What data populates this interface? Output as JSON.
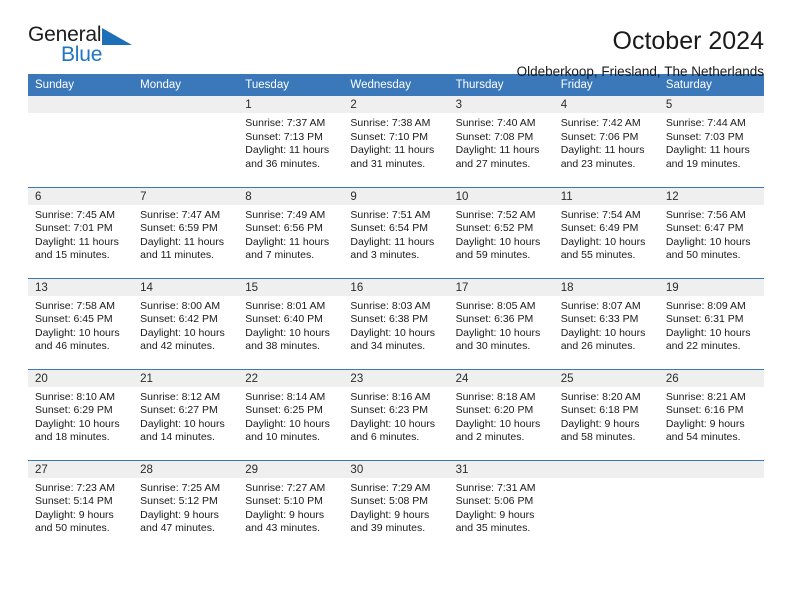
{
  "brand": {
    "name_top": "General",
    "name_bottom": "Blue",
    "accent_color": "#1d6fb8",
    "triangle_icon": "triangle-icon"
  },
  "header": {
    "title": "October 2024",
    "subtitle": "Oldeberkoop, Friesland, The Netherlands"
  },
  "theme": {
    "header_blue": "#3a78ba",
    "daynum_gray": "#efefef",
    "text": "#1a1a1a"
  },
  "weekdays": [
    "Sunday",
    "Monday",
    "Tuesday",
    "Wednesday",
    "Thursday",
    "Friday",
    "Saturday"
  ],
  "weeks": [
    [
      {
        "day": "",
        "sunrise": "",
        "sunset": "",
        "daylight": ""
      },
      {
        "day": "",
        "sunrise": "",
        "sunset": "",
        "daylight": ""
      },
      {
        "day": "1",
        "sunrise": "Sunrise: 7:37 AM",
        "sunset": "Sunset: 7:13 PM",
        "daylight": "Daylight: 11 hours and 36 minutes."
      },
      {
        "day": "2",
        "sunrise": "Sunrise: 7:38 AM",
        "sunset": "Sunset: 7:10 PM",
        "daylight": "Daylight: 11 hours and 31 minutes."
      },
      {
        "day": "3",
        "sunrise": "Sunrise: 7:40 AM",
        "sunset": "Sunset: 7:08 PM",
        "daylight": "Daylight: 11 hours and 27 minutes."
      },
      {
        "day": "4",
        "sunrise": "Sunrise: 7:42 AM",
        "sunset": "Sunset: 7:06 PM",
        "daylight": "Daylight: 11 hours and 23 minutes."
      },
      {
        "day": "5",
        "sunrise": "Sunrise: 7:44 AM",
        "sunset": "Sunset: 7:03 PM",
        "daylight": "Daylight: 11 hours and 19 minutes."
      }
    ],
    [
      {
        "day": "6",
        "sunrise": "Sunrise: 7:45 AM",
        "sunset": "Sunset: 7:01 PM",
        "daylight": "Daylight: 11 hours and 15 minutes."
      },
      {
        "day": "7",
        "sunrise": "Sunrise: 7:47 AM",
        "sunset": "Sunset: 6:59 PM",
        "daylight": "Daylight: 11 hours and 11 minutes."
      },
      {
        "day": "8",
        "sunrise": "Sunrise: 7:49 AM",
        "sunset": "Sunset: 6:56 PM",
        "daylight": "Daylight: 11 hours and 7 minutes."
      },
      {
        "day": "9",
        "sunrise": "Sunrise: 7:51 AM",
        "sunset": "Sunset: 6:54 PM",
        "daylight": "Daylight: 11 hours and 3 minutes."
      },
      {
        "day": "10",
        "sunrise": "Sunrise: 7:52 AM",
        "sunset": "Sunset: 6:52 PM",
        "daylight": "Daylight: 10 hours and 59 minutes."
      },
      {
        "day": "11",
        "sunrise": "Sunrise: 7:54 AM",
        "sunset": "Sunset: 6:49 PM",
        "daylight": "Daylight: 10 hours and 55 minutes."
      },
      {
        "day": "12",
        "sunrise": "Sunrise: 7:56 AM",
        "sunset": "Sunset: 6:47 PM",
        "daylight": "Daylight: 10 hours and 50 minutes."
      }
    ],
    [
      {
        "day": "13",
        "sunrise": "Sunrise: 7:58 AM",
        "sunset": "Sunset: 6:45 PM",
        "daylight": "Daylight: 10 hours and 46 minutes."
      },
      {
        "day": "14",
        "sunrise": "Sunrise: 8:00 AM",
        "sunset": "Sunset: 6:42 PM",
        "daylight": "Daylight: 10 hours and 42 minutes."
      },
      {
        "day": "15",
        "sunrise": "Sunrise: 8:01 AM",
        "sunset": "Sunset: 6:40 PM",
        "daylight": "Daylight: 10 hours and 38 minutes."
      },
      {
        "day": "16",
        "sunrise": "Sunrise: 8:03 AM",
        "sunset": "Sunset: 6:38 PM",
        "daylight": "Daylight: 10 hours and 34 minutes."
      },
      {
        "day": "17",
        "sunrise": "Sunrise: 8:05 AM",
        "sunset": "Sunset: 6:36 PM",
        "daylight": "Daylight: 10 hours and 30 minutes."
      },
      {
        "day": "18",
        "sunrise": "Sunrise: 8:07 AM",
        "sunset": "Sunset: 6:33 PM",
        "daylight": "Daylight: 10 hours and 26 minutes."
      },
      {
        "day": "19",
        "sunrise": "Sunrise: 8:09 AM",
        "sunset": "Sunset: 6:31 PM",
        "daylight": "Daylight: 10 hours and 22 minutes."
      }
    ],
    [
      {
        "day": "20",
        "sunrise": "Sunrise: 8:10 AM",
        "sunset": "Sunset: 6:29 PM",
        "daylight": "Daylight: 10 hours and 18 minutes."
      },
      {
        "day": "21",
        "sunrise": "Sunrise: 8:12 AM",
        "sunset": "Sunset: 6:27 PM",
        "daylight": "Daylight: 10 hours and 14 minutes."
      },
      {
        "day": "22",
        "sunrise": "Sunrise: 8:14 AM",
        "sunset": "Sunset: 6:25 PM",
        "daylight": "Daylight: 10 hours and 10 minutes."
      },
      {
        "day": "23",
        "sunrise": "Sunrise: 8:16 AM",
        "sunset": "Sunset: 6:23 PM",
        "daylight": "Daylight: 10 hours and 6 minutes."
      },
      {
        "day": "24",
        "sunrise": "Sunrise: 8:18 AM",
        "sunset": "Sunset: 6:20 PM",
        "daylight": "Daylight: 10 hours and 2 minutes."
      },
      {
        "day": "25",
        "sunrise": "Sunrise: 8:20 AM",
        "sunset": "Sunset: 6:18 PM",
        "daylight": "Daylight: 9 hours and 58 minutes."
      },
      {
        "day": "26",
        "sunrise": "Sunrise: 8:21 AM",
        "sunset": "Sunset: 6:16 PM",
        "daylight": "Daylight: 9 hours and 54 minutes."
      }
    ],
    [
      {
        "day": "27",
        "sunrise": "Sunrise: 7:23 AM",
        "sunset": "Sunset: 5:14 PM",
        "daylight": "Daylight: 9 hours and 50 minutes."
      },
      {
        "day": "28",
        "sunrise": "Sunrise: 7:25 AM",
        "sunset": "Sunset: 5:12 PM",
        "daylight": "Daylight: 9 hours and 47 minutes."
      },
      {
        "day": "29",
        "sunrise": "Sunrise: 7:27 AM",
        "sunset": "Sunset: 5:10 PM",
        "daylight": "Daylight: 9 hours and 43 minutes."
      },
      {
        "day": "30",
        "sunrise": "Sunrise: 7:29 AM",
        "sunset": "Sunset: 5:08 PM",
        "daylight": "Daylight: 9 hours and 39 minutes."
      },
      {
        "day": "31",
        "sunrise": "Sunrise: 7:31 AM",
        "sunset": "Sunset: 5:06 PM",
        "daylight": "Daylight: 9 hours and 35 minutes."
      },
      {
        "day": "",
        "sunrise": "",
        "sunset": "",
        "daylight": ""
      },
      {
        "day": "",
        "sunrise": "",
        "sunset": "",
        "daylight": ""
      }
    ]
  ]
}
